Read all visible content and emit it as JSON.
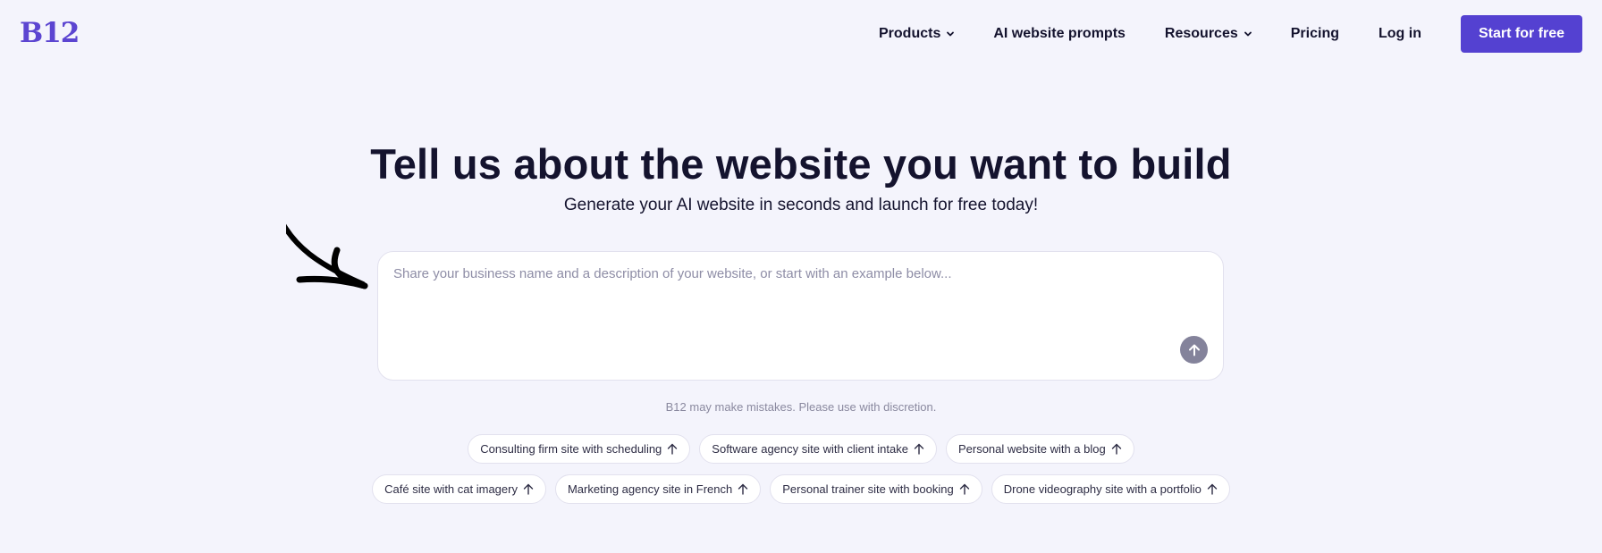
{
  "header": {
    "logo": "B12",
    "nav": {
      "products": "Products",
      "prompts": "AI website prompts",
      "resources": "Resources",
      "pricing": "Pricing",
      "login": "Log in"
    },
    "cta": "Start for free"
  },
  "hero": {
    "title": "Tell us about the website you want to build",
    "subtitle": "Generate your AI website in seconds and launch for free today!"
  },
  "prompt": {
    "value": "",
    "placeholder": "Share your business name and a description of your website, or start with an example below..."
  },
  "disclaimer": "B12 may make mistakes. Please use with discretion.",
  "examples": {
    "row1": [
      "Consulting firm site with scheduling",
      "Software agency site with client intake",
      "Personal website with a blog"
    ],
    "row2": [
      "Café site with cat imagery",
      "Marketing agency site in French",
      "Personal trainer site with booking",
      "Drone videography site with a portfolio"
    ]
  },
  "colors": {
    "background": "#f4f4fc",
    "brand": "#5441d1",
    "text": "#14132e",
    "submit": "#84839b"
  },
  "icons": {
    "nav_dropdown": "chevron-down-icon",
    "submit": "arrow-up-icon",
    "chip": "arrow-up-icon",
    "decoration": "hand-drawn-arrow-icon"
  }
}
